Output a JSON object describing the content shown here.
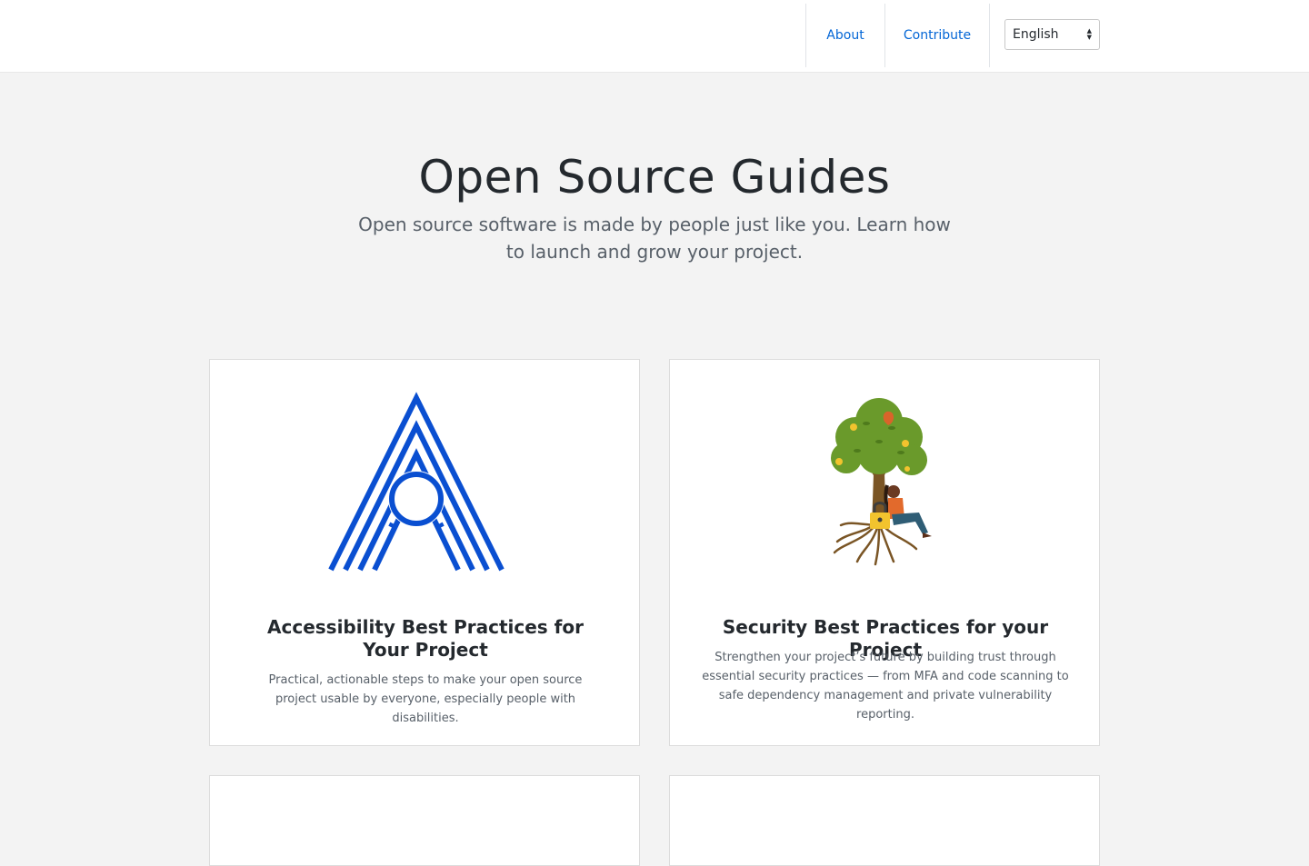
{
  "header": {
    "nav": [
      {
        "label": "About"
      },
      {
        "label": "Contribute"
      }
    ],
    "language": {
      "selected": "English"
    }
  },
  "hero": {
    "title": "Open Source Guides",
    "subtitle": "Open source software is made by people just like you. Learn how to launch and grow your project."
  },
  "cards": [
    {
      "title": "Accessibility Best Practices for Your Project",
      "description": "Practical, actionable steps to make your open source project usable by everyone, especially people with disabilities.",
      "art": "accessibility-logo-icon"
    },
    {
      "title": "Security Best Practices for your Project",
      "description": "Strengthen your project’s future by building trust through essential security practices — from MFA and code scanning to safe dependency management and private vulnerability reporting.",
      "art": "tree-with-person-illustration"
    },
    {
      "title": "",
      "description": ""
    },
    {
      "title": "",
      "description": ""
    }
  ],
  "colors": {
    "link": "#0366d6",
    "accessibility_blue": "#0a4fd1",
    "background": "#f3f3f3"
  }
}
